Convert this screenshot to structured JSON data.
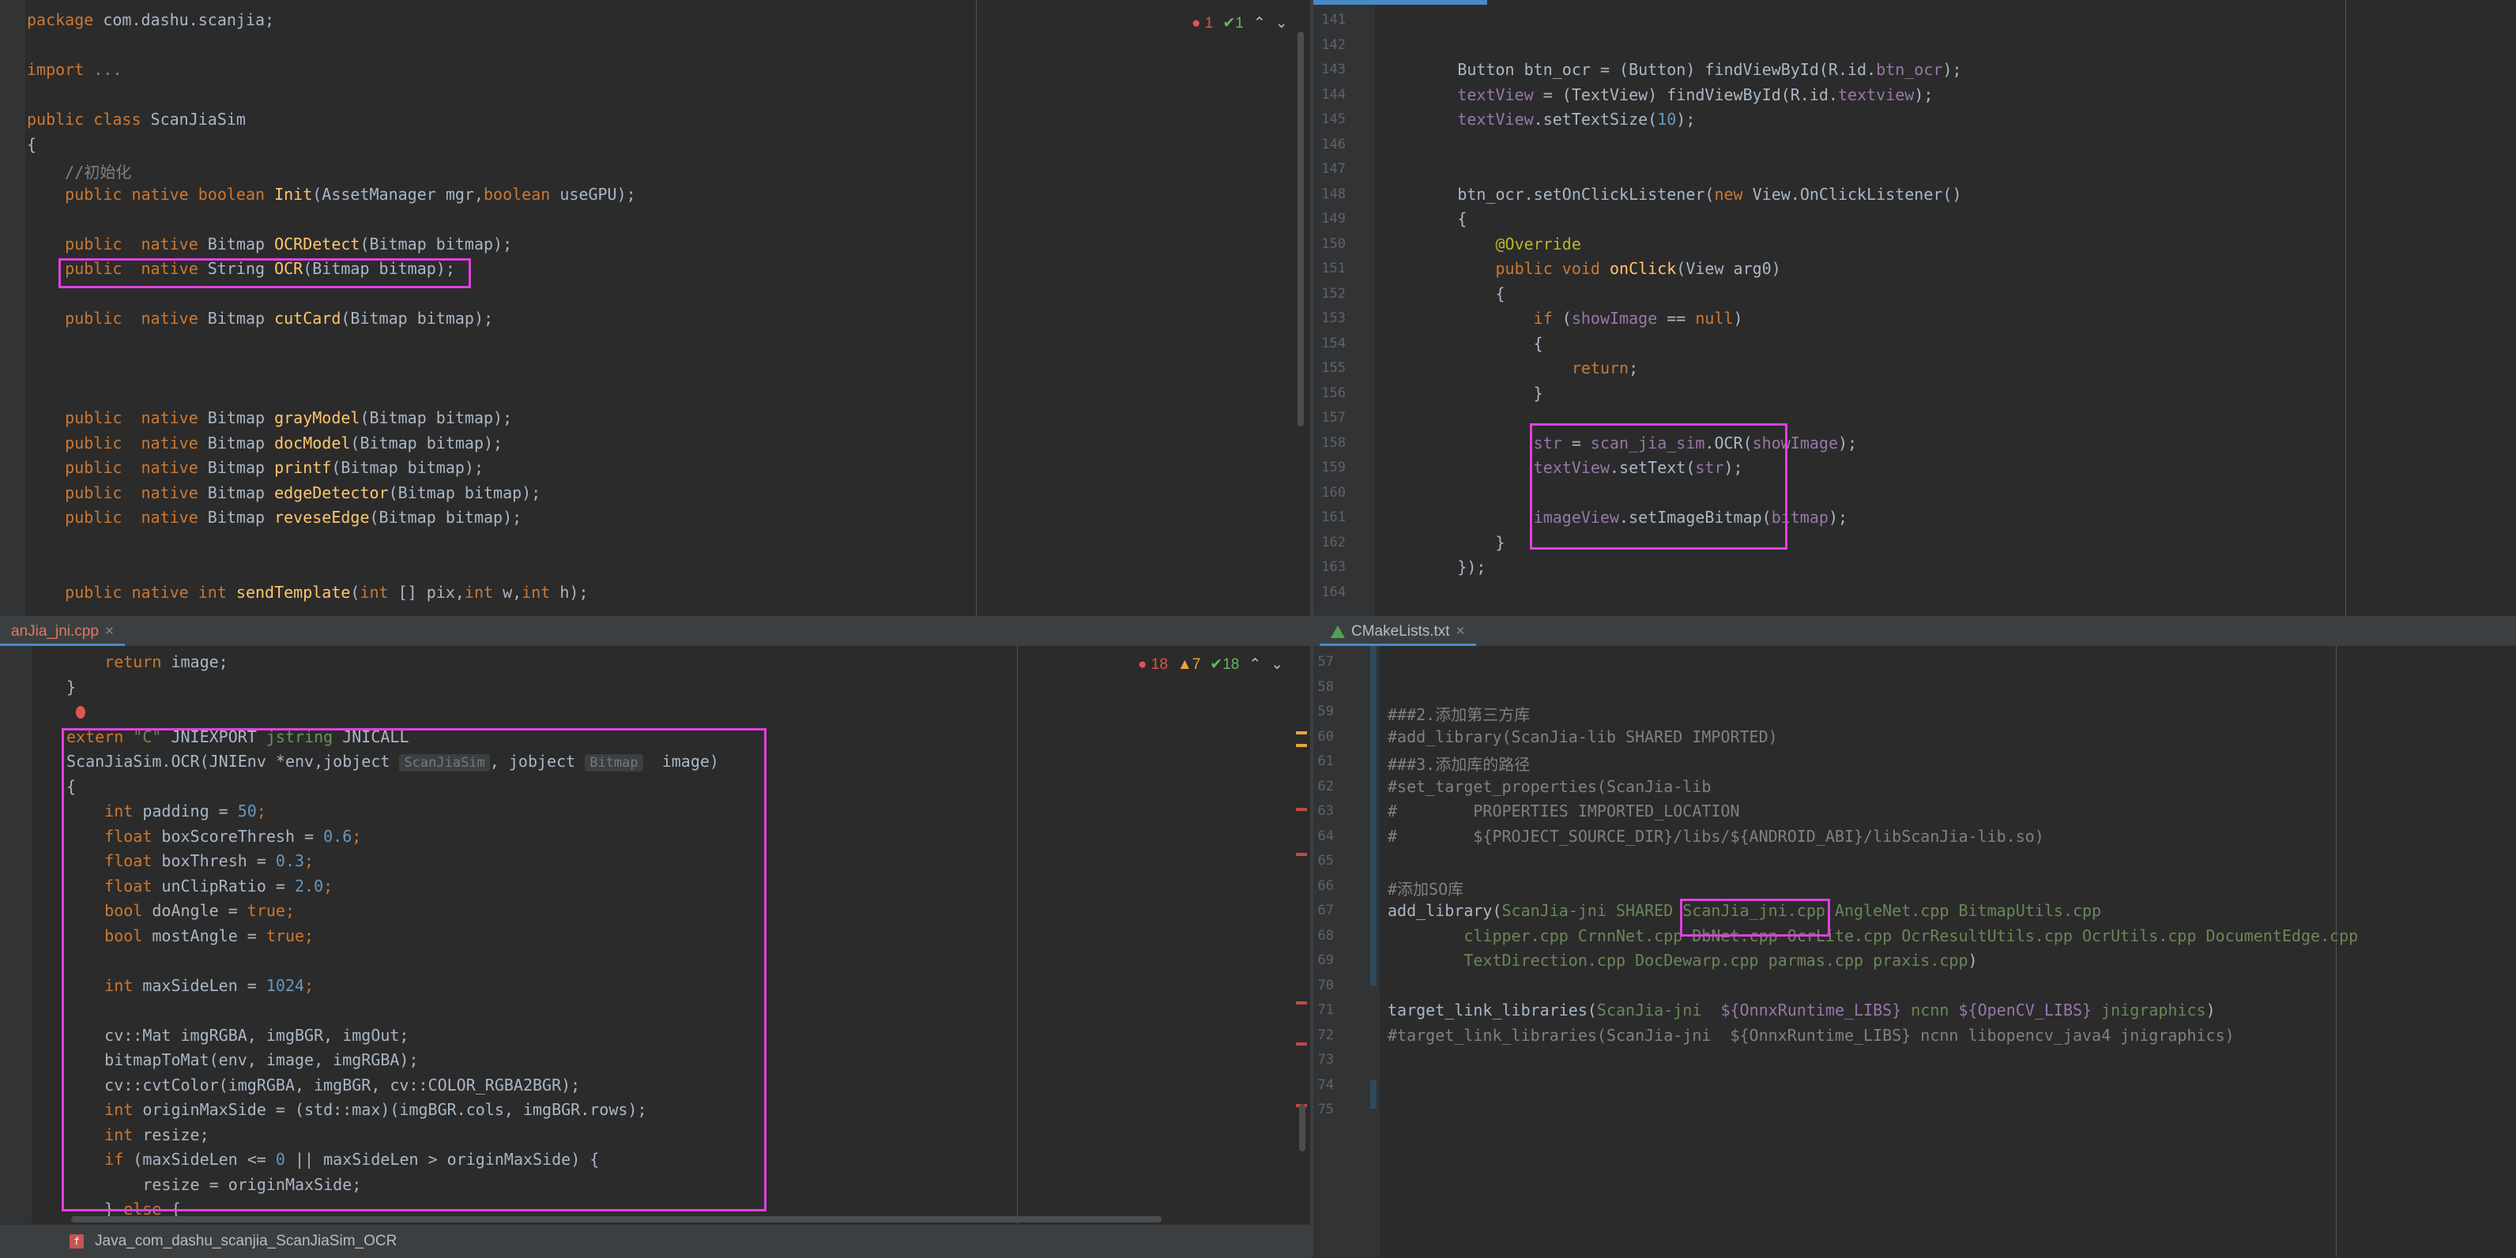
{
  "top_left": {
    "badge": {
      "errors": "1",
      "ok": "1"
    },
    "lines": [
      [
        [
          "kw",
          "package "
        ],
        [
          "",
          "com.dashu.scanjia;"
        ]
      ],
      [],
      [
        [
          "kw",
          "import "
        ],
        [
          "cm",
          "..."
        ]
      ],
      [],
      [
        [
          "kw",
          "public class "
        ],
        [
          "",
          "ScanJiaSim"
        ]
      ],
      [
        [
          "",
          "{"
        ]
      ],
      [
        [
          "cm",
          "    //初始化"
        ]
      ],
      [
        [
          "kw",
          "    public native boolean "
        ],
        [
          "fn",
          "Init"
        ],
        [
          "",
          "(AssetManager mgr,"
        ],
        [
          "kw",
          "boolean "
        ],
        [
          "",
          "useGPU);"
        ]
      ],
      [],
      [
        [
          "kw",
          "    public  native "
        ],
        [
          "",
          "Bitmap "
        ],
        [
          "fn",
          "OCRDetect"
        ],
        [
          "",
          "(Bitmap bitmap);"
        ]
      ],
      [
        [
          "kw",
          "    public  native "
        ],
        [
          "",
          "String "
        ],
        [
          "fn",
          "OCR"
        ],
        [
          "",
          "(Bitmap bitmap);"
        ]
      ],
      [],
      [
        [
          "kw",
          "    public  native "
        ],
        [
          "",
          "Bitmap "
        ],
        [
          "fn",
          "cutCard"
        ],
        [
          "",
          "(Bitmap bitmap);"
        ]
      ],
      [],
      [],
      [],
      [
        [
          "kw",
          "    public  native "
        ],
        [
          "",
          "Bitmap "
        ],
        [
          "fn",
          "grayModel"
        ],
        [
          "",
          "(Bitmap bitmap);"
        ]
      ],
      [
        [
          "kw",
          "    public  native "
        ],
        [
          "",
          "Bitmap "
        ],
        [
          "fn",
          "docModel"
        ],
        [
          "",
          "(Bitmap bitmap);"
        ]
      ],
      [
        [
          "kw",
          "    public  native "
        ],
        [
          "",
          "Bitmap "
        ],
        [
          "fn",
          "printf"
        ],
        [
          "",
          "(Bitmap bitmap);"
        ]
      ],
      [
        [
          "kw",
          "    public  native "
        ],
        [
          "",
          "Bitmap "
        ],
        [
          "fn",
          "edgeDetector"
        ],
        [
          "",
          "(Bitmap bitmap);"
        ]
      ],
      [
        [
          "kw",
          "    public  native "
        ],
        [
          "",
          "Bitmap "
        ],
        [
          "fn",
          "reveseEdge"
        ],
        [
          "",
          "(Bitmap bitmap);"
        ]
      ],
      [],
      [],
      [
        [
          "kw",
          "    public native int "
        ],
        [
          "fn",
          "sendTemplate"
        ],
        [
          "",
          "("
        ],
        [
          "kw",
          "int "
        ],
        [
          "",
          "[] pix,"
        ],
        [
          "kw",
          "int "
        ],
        [
          "",
          "w,"
        ],
        [
          "kw",
          "int "
        ],
        [
          "",
          "h);"
        ]
      ]
    ]
  },
  "top_right": {
    "line_numbers": [
      "141",
      "142",
      "143",
      "144",
      "145",
      "146",
      "147",
      "148",
      "149",
      "150",
      "151",
      "152",
      "153",
      "154",
      "155",
      "156",
      "157",
      "158",
      "159",
      "160",
      "161",
      "162",
      "163",
      "164"
    ],
    "lines": [
      [],
      [],
      [
        [
          "",
          "        Button btn_ocr = (Button) findViewById(R.id."
        ],
        [
          "fld",
          "btn_ocr"
        ],
        [
          "",
          ");"
        ]
      ],
      [
        [
          "fld",
          "        textView "
        ],
        [
          "",
          "= (TextView) findViewById(R.id."
        ],
        [
          "fld",
          "textview"
        ],
        [
          "",
          ");"
        ]
      ],
      [
        [
          "fld",
          "        textView"
        ],
        [
          "",
          ".setTextSize("
        ],
        [
          "num",
          "10"
        ],
        [
          "",
          ");"
        ]
      ],
      [],
      [],
      [
        [
          "",
          "        btn_ocr.setOnClickListener("
        ],
        [
          "kw",
          "new "
        ],
        [
          "",
          "View.OnClickListener()"
        ]
      ],
      [
        [
          "",
          "        {"
        ]
      ],
      [
        [
          "ann",
          "            @Override"
        ]
      ],
      [
        [
          "kw",
          "            public void "
        ],
        [
          "fn",
          "onClick"
        ],
        [
          "",
          "(View arg0)"
        ]
      ],
      [
        [
          "",
          "            {"
        ]
      ],
      [
        [
          "kw",
          "                if "
        ],
        [
          "",
          "("
        ],
        [
          "fld",
          "showImage "
        ],
        [
          "",
          "== "
        ],
        [
          "kw",
          "null"
        ],
        [
          "",
          ")"
        ]
      ],
      [
        [
          "",
          "                {"
        ]
      ],
      [
        [
          "kw",
          "                    return"
        ],
        [
          "",
          ";"
        ]
      ],
      [
        [
          "",
          "                }"
        ]
      ],
      [],
      [
        [
          "fld",
          "                str "
        ],
        [
          "",
          "= "
        ],
        [
          "fld",
          "scan_jia_sim"
        ],
        [
          "",
          ".OCR("
        ],
        [
          "fld",
          "showImage"
        ],
        [
          "",
          ");"
        ]
      ],
      [
        [
          "fld",
          "                textView"
        ],
        [
          "",
          ".setText("
        ],
        [
          "fld",
          "str"
        ],
        [
          "",
          ");"
        ]
      ],
      [],
      [
        [
          "fld",
          "                imageView"
        ],
        [
          "",
          ".setImageBitmap("
        ],
        [
          "fld",
          "bitmap"
        ],
        [
          "",
          ");"
        ]
      ],
      [
        [
          "",
          "            }"
        ]
      ],
      [
        [
          "",
          "        });"
        ]
      ],
      []
    ]
  },
  "bottom_left": {
    "tab_label": "anJia_jni.cpp",
    "badge": {
      "errors": "18",
      "warnings": "7",
      "ok": "18"
    },
    "breadcrumb": "Java_com_dashu_scanjia_ScanJiaSim_OCR",
    "lines": [
      [
        [
          "kw",
          "    return "
        ],
        [
          "",
          "image;"
        ]
      ],
      [
        [
          "",
          "}"
        ]
      ],
      [],
      [
        [
          "kw",
          "extern "
        ],
        [
          "str",
          "\"C\" "
        ],
        [
          "",
          "JNIEXPORT "
        ],
        [
          "cmk",
          "jstring "
        ],
        [
          "",
          "JNICALL"
        ]
      ],
      [
        [
          "",
          "ScanJiaSim.OCR(JNIEnv *env,jobject "
        ],
        [
          "hint",
          "ScanJiaSim"
        ],
        [
          "",
          ", jobject "
        ],
        [
          "hint",
          "Bitmap"
        ],
        [
          "",
          "  image)"
        ]
      ],
      [
        [
          "",
          "{"
        ]
      ],
      [
        [
          "kw",
          "    int "
        ],
        [
          "",
          "padding = "
        ],
        [
          "num",
          "50"
        ],
        [
          "kw",
          ";"
        ]
      ],
      [
        [
          "kw",
          "    float "
        ],
        [
          "",
          "boxScoreThresh = "
        ],
        [
          "num",
          "0.6"
        ],
        [
          "kw",
          ";"
        ]
      ],
      [
        [
          "kw",
          "    float "
        ],
        [
          "",
          "boxThresh = "
        ],
        [
          "num",
          "0.3"
        ],
        [
          "kw",
          ";"
        ]
      ],
      [
        [
          "kw",
          "    float "
        ],
        [
          "",
          "unClipRatio = "
        ],
        [
          "num",
          "2.0"
        ],
        [
          "kw",
          ";"
        ]
      ],
      [
        [
          "kw",
          "    bool "
        ],
        [
          "",
          "doAngle = "
        ],
        [
          "kw",
          "true;"
        ]
      ],
      [
        [
          "kw",
          "    bool "
        ],
        [
          "",
          "mostAngle = "
        ],
        [
          "kw",
          "true;"
        ]
      ],
      [],
      [
        [
          "kw",
          "    int "
        ],
        [
          "",
          "maxSideLen = "
        ],
        [
          "num",
          "1024"
        ],
        [
          "kw",
          ";"
        ]
      ],
      [],
      [
        [
          "",
          "    cv::Mat imgRGBA, imgBGR, imgOut;"
        ]
      ],
      [
        [
          "",
          "    bitmapToMat(env, image, imgRGBA);"
        ]
      ],
      [
        [
          "",
          "    cv::cvtColor(imgRGBA, imgBGR, cv::COLOR_RGBA2BGR);"
        ]
      ],
      [
        [
          "kw",
          "    int "
        ],
        [
          "",
          "originMaxSide = (std::max)(imgBGR.cols, imgBGR.rows);"
        ]
      ],
      [
        [
          "kw",
          "    int "
        ],
        [
          "",
          "resize;"
        ]
      ],
      [
        [
          "kw",
          "    if "
        ],
        [
          "",
          "(maxSideLen <= "
        ],
        [
          "num",
          "0 "
        ],
        [
          "",
          "|| maxSideLen > originMaxSide) {"
        ]
      ],
      [
        [
          "",
          "        resize = originMaxSide;"
        ]
      ],
      [
        [
          "",
          "    } "
        ],
        [
          "kw",
          "else "
        ],
        [
          "",
          "{"
        ]
      ]
    ]
  },
  "bottom_right": {
    "tab_label": "CMakeLists.txt",
    "line_numbers": [
      "57",
      "58",
      "59",
      "60",
      "61",
      "62",
      "63",
      "64",
      "65",
      "66",
      "67",
      "68",
      "69",
      "70",
      "71",
      "72",
      "73",
      "74",
      "75"
    ],
    "lines": [
      [],
      [],
      [
        [
          "cm",
          "###2.添加第三方库"
        ]
      ],
      [
        [
          "cm",
          "#add_library(ScanJia-lib SHARED IMPORTED)"
        ]
      ],
      [
        [
          "cm",
          "###3.添加库的路径"
        ]
      ],
      [
        [
          "cm",
          "#set_target_properties(ScanJia-lib"
        ]
      ],
      [
        [
          "cm",
          "#        PROPERTIES IMPORTED_LOCATION"
        ]
      ],
      [
        [
          "cm",
          "#        ${PROJECT_SOURCE_DIR}/libs/${ANDROID_ABI}/libScanJia-lib.so)"
        ]
      ],
      [],
      [
        [
          "cm",
          "#添加SO库"
        ]
      ],
      [
        [
          "",
          "add_library("
        ],
        [
          "str",
          "ScanJia-jni SHARED ScanJia_jni.cpp AngleNet.cpp BitmapUtils.cpp"
        ]
      ],
      [
        [
          "str",
          "        clipper.cpp CrnnNet.cpp DbNet.cpp OcrLite.cpp OcrResultUtils.cpp OcrUtils.cpp DocumentEdge.cpp"
        ]
      ],
      [
        [
          "str",
          "        TextDirection.cpp DocDewarp.cpp parmas.cpp praxis.cpp"
        ],
        [
          "",
          ")"
        ]
      ],
      [],
      [
        [
          "",
          "target_link_libraries("
        ],
        [
          "str",
          "ScanJia-jni  "
        ],
        [
          "fld",
          "${OnnxRuntime_LIBS} "
        ],
        [
          "str",
          "ncnn "
        ],
        [
          "fld",
          "${OpenCV_LIBS} "
        ],
        [
          "str",
          "jnigraphics"
        ],
        [
          "",
          ")"
        ]
      ],
      [
        [
          "cm",
          "#target_link_libraries(ScanJia-jni  ${OnnxRuntime_LIBS} ncnn libopencv_java4 jnigraphics)"
        ]
      ],
      [],
      [],
      []
    ]
  }
}
